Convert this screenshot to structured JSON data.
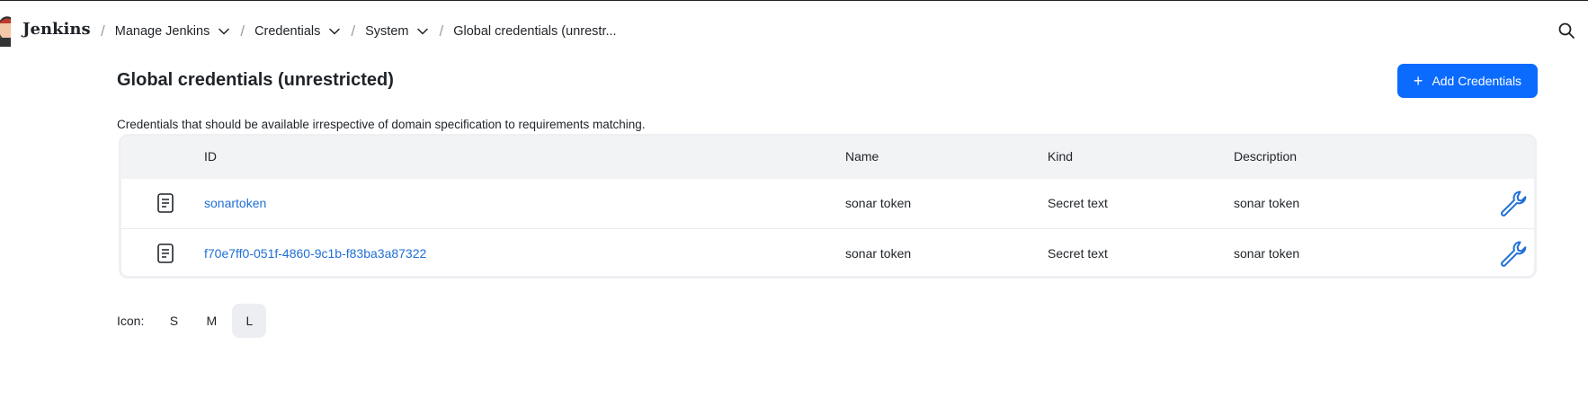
{
  "app": {
    "brand": "Jenkins"
  },
  "breadcrumbs": [
    {
      "label": "Manage Jenkins"
    },
    {
      "label": "Credentials"
    },
    {
      "label": "System"
    },
    {
      "label": "Global credentials (unrestr..."
    }
  ],
  "page": {
    "title": "Global credentials (unrestricted)",
    "description": "Credentials that should be available irrespective of domain specification to requirements matching.",
    "add_button": "Add Credentials"
  },
  "table": {
    "headers": {
      "id": "ID",
      "name": "Name",
      "kind": "Kind",
      "description": "Description"
    },
    "rows": [
      {
        "id": "sonartoken",
        "name": "sonar token",
        "kind": "Secret text",
        "description": "sonar token"
      },
      {
        "id": "f70e7ff0-051f-4860-9c1b-f83ba3a87322",
        "name": "sonar token",
        "kind": "Secret text",
        "description": "sonar token"
      }
    ]
  },
  "icon_size": {
    "label": "Icon:",
    "options": [
      "S",
      "M",
      "L"
    ],
    "selected": "L"
  },
  "colors": {
    "accent": "#0b6bff",
    "link": "#1f6fd6"
  },
  "icons": {
    "search": "search-icon",
    "row": "document-icon",
    "configure": "wrench-icon"
  }
}
